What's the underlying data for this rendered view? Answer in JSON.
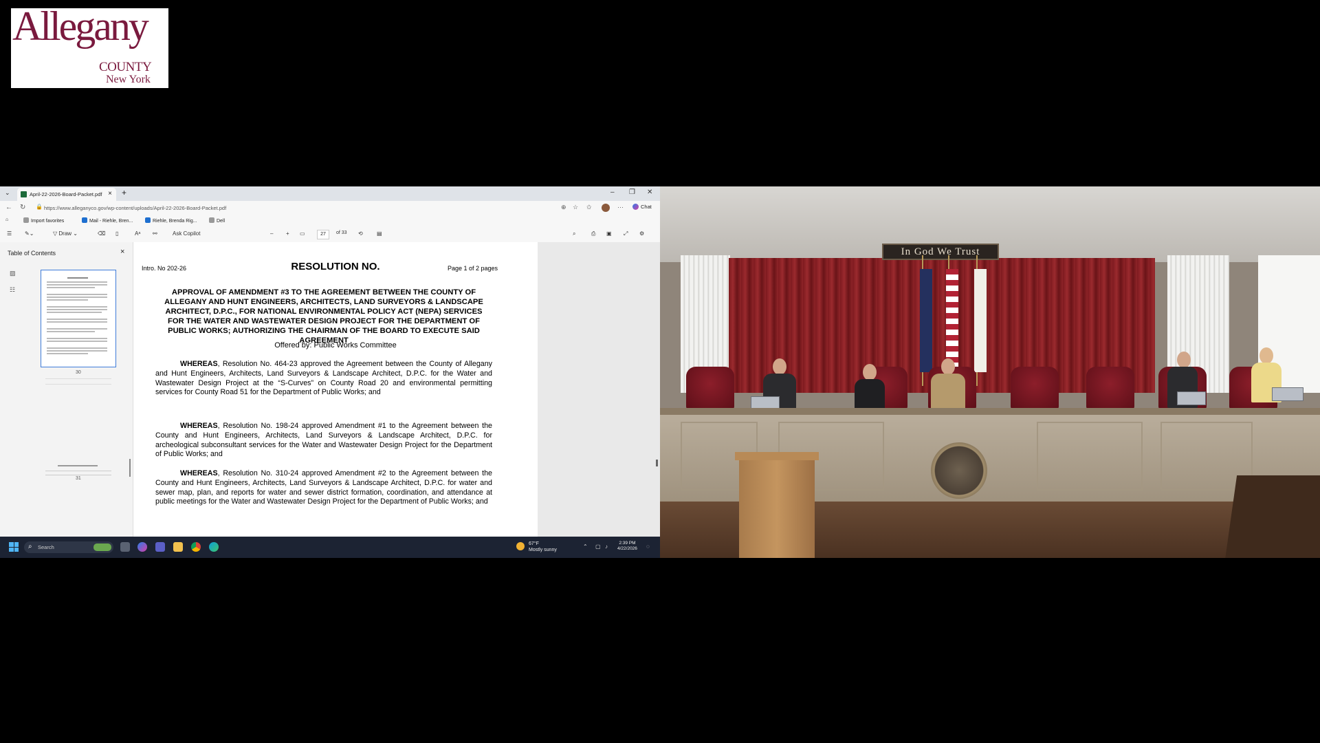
{
  "logo": {
    "word": "Allegany",
    "county": "COUNTY",
    "state": "New York"
  },
  "browser": {
    "tab_title": "April-22-2026-Board-Packet.pdf",
    "url": "https://www.alleganyco.gov/wp-content/uploads/April-22-2026-Board-Packet.pdf",
    "chat_label": "Chat",
    "favorites": [
      {
        "label": "Import favorites"
      },
      {
        "label": "Mail - Riehle, Bren..."
      },
      {
        "label": "Riehle, Brenda Rig..."
      },
      {
        "label": "Dell"
      }
    ],
    "pdf_toolbar": {
      "draw_label": "Draw",
      "ask_copilot_label": "Ask Copilot",
      "current_page": "27",
      "page_total": "of 33",
      "minus": "–",
      "plus": "+"
    },
    "toc": {
      "title": "Table of Contents",
      "thumbs": [
        "30",
        "31"
      ]
    },
    "document": {
      "intro": "Intro. No 202-26",
      "resolution_title": "RESOLUTION NO.",
      "page_info": "Page 1 of 2 pages",
      "heading": "APPROVAL OF AMENDMENT #3 TO THE AGREEMENT BETWEEN THE COUNTY OF ALLEGANY AND HUNT ENGINEERS, ARCHITECTS, LAND SURVEYORS & LANDSCAPE ARCHITECT, D.P.C., FOR NATIONAL ENVIRONMENTAL POLICY ACT (NEPA) SERVICES FOR THE WATER AND WASTEWATER DESIGN PROJECT FOR THE DEPARTMENT OF PUBLIC WORKS; AUTHORIZING THE CHAIRMAN OF THE BOARD TO EXECUTE SAID AGREEMENT",
      "offered_by": "Offered by: Public Works Committee",
      "whereas_label": "WHEREAS",
      "paragraphs": [
        ", Resolution No. 464-23 approved the Agreement between the County of Allegany and Hunt Engineers, Architects, Land Surveyors & Landscape Architect, D.P.C. for the Water and Wastewater Design Project at the “S-Curves” on County Road 20 and environmental permitting services for County Road 51 for the Department of Public Works; and",
        ", Resolution No. 198-24 approved Amendment #1 to the Agreement between the County and Hunt Engineers, Architects, Land Surveyors & Landscape Architect, D.P.C. for archeological subconsultant services for the Water and Wastewater Design Project for the Department of Public Works; and",
        ", Resolution No. 310-24 approved Amendment #2 to the Agreement between the County and Hunt Engineers, Architects, Land Surveyors & Landscape Architect, D.P.C. for water and sewer map, plan, and reports for water and sewer district formation, coordination, and attendance at public meetings for the Water and Wastewater Design Project for the Department of Public Works; and"
      ]
    },
    "taskbar": {
      "search_placeholder": "Search",
      "temperature": "67°F",
      "weather": "Mostly sunny",
      "time": "2:39 PM",
      "date": "4/22/2026"
    }
  },
  "video": {
    "motto": "In God We Trust"
  },
  "colors": {
    "logo_maroon": "#7a1a3e",
    "taskbar": "#1c2333",
    "curtain": "#8f2428",
    "accent_blue": "#3d7bd9"
  }
}
